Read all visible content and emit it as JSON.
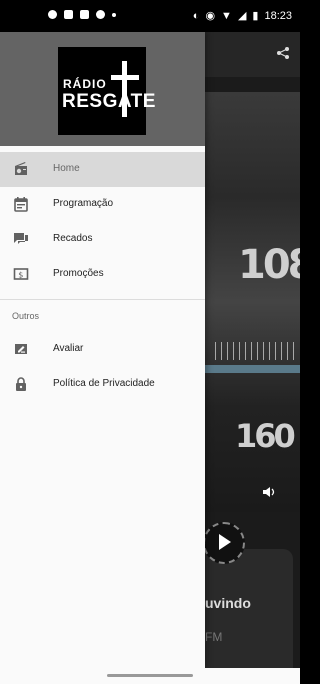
{
  "status_bar": {
    "time": "18:23"
  },
  "drawer": {
    "logo": {
      "line1": "RÁDIO",
      "line2": "RESGATE"
    },
    "items": [
      {
        "label": "Home",
        "icon": "radio-icon",
        "active": true
      },
      {
        "label": "Programação",
        "icon": "calendar-icon",
        "active": false
      },
      {
        "label": "Recados",
        "icon": "chat-icon",
        "active": false
      },
      {
        "label": "Promoções",
        "icon": "dollar-icon",
        "active": false
      }
    ],
    "section_title": "Outros",
    "other_items": [
      {
        "label": "Avaliar",
        "icon": "rate-icon"
      },
      {
        "label": "Política de Privacidade",
        "icon": "lock-icon"
      }
    ]
  },
  "background": {
    "dial_top": "108",
    "dial_bottom": "160",
    "now_playing_label": "uvindo",
    "band_label": "FM"
  },
  "colors": {
    "drawer_header": "#646464",
    "active_item": "#d9d9d9",
    "icon": "#616161"
  }
}
